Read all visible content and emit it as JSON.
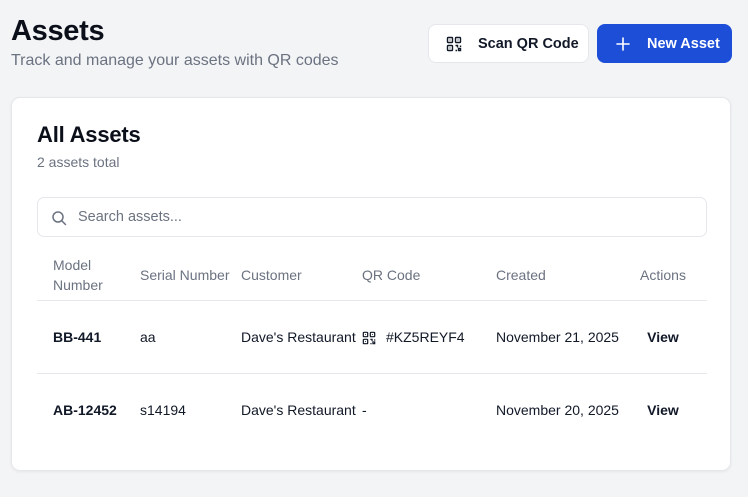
{
  "header": {
    "title": "Assets",
    "subtitle": "Track and manage your assets with QR codes",
    "scan_label": "Scan QR Code",
    "new_label": "New Asset"
  },
  "card": {
    "title": "All Assets",
    "subtitle": "2 assets total"
  },
  "search": {
    "placeholder": "Search assets..."
  },
  "table": {
    "columns": {
      "model": "Model Number",
      "serial": "Serial Number",
      "customer": "Customer",
      "qr": "QR Code",
      "created": "Created",
      "actions": "Actions"
    },
    "rows": [
      {
        "model": "BB-441",
        "serial": "aa",
        "customer": "Dave's Restaurant",
        "qr": "#KZ5REYF4",
        "created": "November 21, 2025",
        "action": "View"
      },
      {
        "model": "AB-12452",
        "serial": "s14194",
        "customer": "Dave's Restaurant",
        "qr": "-",
        "created": "November 20, 2025",
        "action": "View"
      }
    ]
  },
  "icons": {
    "scan": "qr-code-icon",
    "new": "plus-icon",
    "search": "search-icon",
    "qr": "qr-code-icon"
  },
  "colors": {
    "primary": "#1d4ed8",
    "background": "#f3f4f6",
    "muted_text": "#6b7280"
  }
}
